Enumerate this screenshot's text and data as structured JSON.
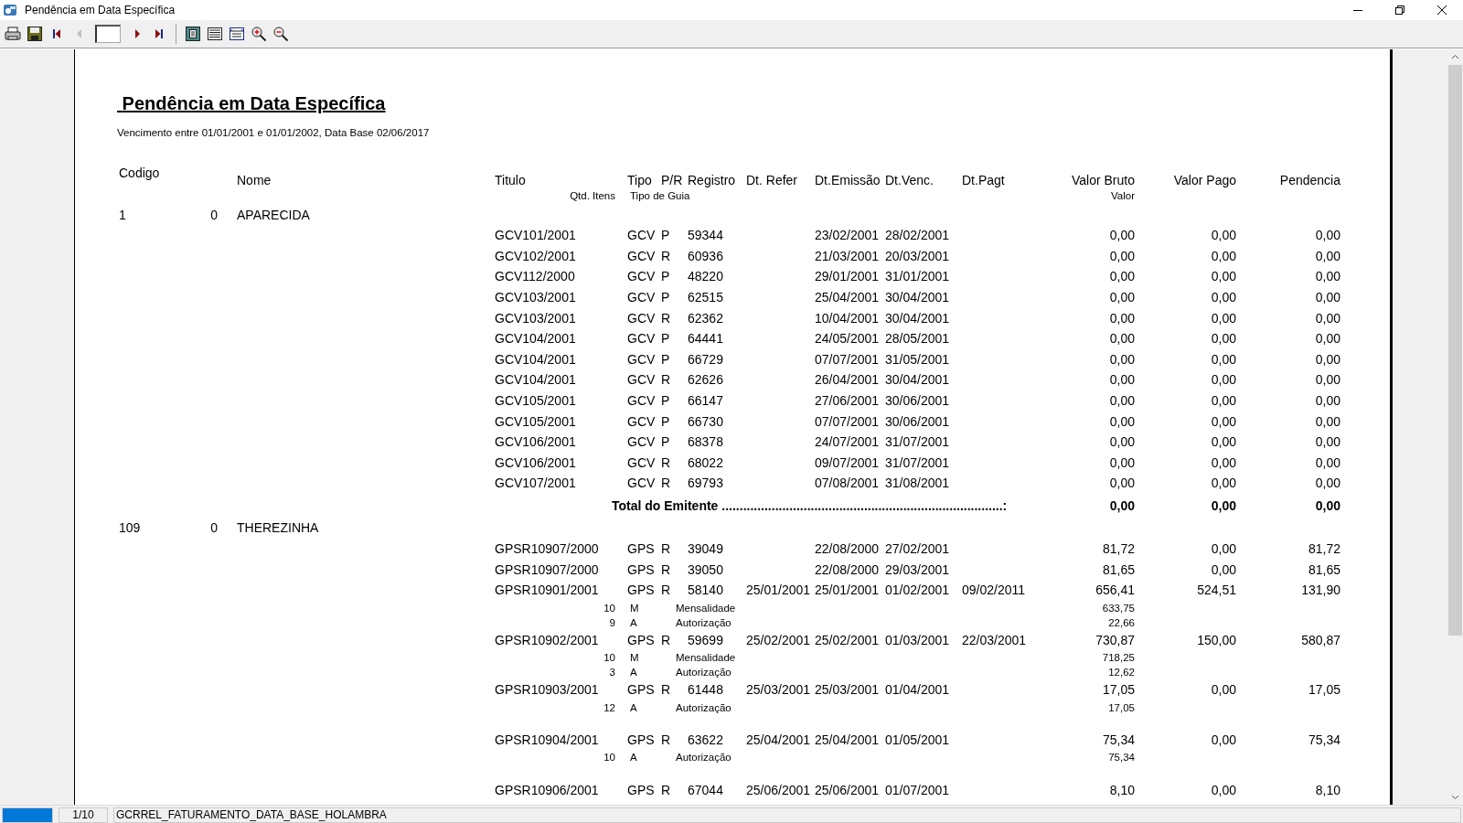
{
  "window": {
    "title": "Pendência em Data Específica"
  },
  "toolbar": {
    "buttons": [
      {
        "kind": "print",
        "disabled": false
      },
      {
        "kind": "save",
        "disabled": false
      },
      {
        "kind": "first",
        "disabled": false
      },
      {
        "kind": "prev",
        "disabled": true
      },
      {
        "kind": "page_field"
      },
      {
        "kind": "next",
        "disabled": false
      },
      {
        "kind": "last",
        "disabled": false
      },
      {
        "kind": "separator"
      },
      {
        "kind": "one_page",
        "disabled": false
      },
      {
        "kind": "lines",
        "disabled": false
      },
      {
        "kind": "page_width",
        "disabled": false
      },
      {
        "kind": "zoom_in",
        "disabled": false
      },
      {
        "kind": "zoom_out",
        "disabled": false
      }
    ]
  },
  "report": {
    "title": "Pendência em Data Específica",
    "subtitle": "Vencimento entre 01/01/2001 e 01/01/2002, Data Base 02/06/2017",
    "columns": [
      "Codigo",
      "Nome",
      "Titulo",
      "Tipo",
      "P/R",
      "Registro",
      "Dt. Refer",
      "Dt.Emissão",
      "Dt.Venc.",
      "Dt.Pagt",
      "Valor Bruto",
      "Valor Pago",
      "Pendencia"
    ],
    "subcolumns": [
      "Qtd. Itens",
      "Tipo de Guia",
      "Valor"
    ],
    "groups": [
      {
        "codigo": "1",
        "column_2": "0",
        "nome": "APARECIDA",
        "rows": [
          {
            "titulo": "GCV101/2001",
            "tipo": "GCV",
            "pr": "P",
            "registro": "59344",
            "dt_emissao": "23/02/2001",
            "dt_venc": "28/02/2001",
            "valor_bruto": "0,00",
            "valor_pago": "0,00",
            "pendencia": "0,00"
          },
          {
            "titulo": "GCV102/2001",
            "tipo": "GCV",
            "pr": "R",
            "registro": "60936",
            "dt_emissao": "21/03/2001",
            "dt_venc": "20/03/2001",
            "valor_bruto": "0,00",
            "valor_pago": "0,00",
            "pendencia": "0,00"
          },
          {
            "titulo": "GCV112/2000",
            "tipo": "GCV",
            "pr": "P",
            "registro": "48220",
            "dt_emissao": "29/01/2001",
            "dt_venc": "31/01/2001",
            "valor_bruto": "0,00",
            "valor_pago": "0,00",
            "pendencia": "0,00"
          },
          {
            "titulo": "GCV103/2001",
            "tipo": "GCV",
            "pr": "P",
            "registro": "62515",
            "dt_emissao": "25/04/2001",
            "dt_venc": "30/04/2001",
            "valor_bruto": "0,00",
            "valor_pago": "0,00",
            "pendencia": "0,00"
          },
          {
            "titulo": "GCV103/2001",
            "tipo": "GCV",
            "pr": "R",
            "registro": "62362",
            "dt_emissao": "10/04/2001",
            "dt_venc": "30/04/2001",
            "valor_bruto": "0,00",
            "valor_pago": "0,00",
            "pendencia": "0,00"
          },
          {
            "titulo": "GCV104/2001",
            "tipo": "GCV",
            "pr": "P",
            "registro": "64441",
            "dt_emissao": "24/05/2001",
            "dt_venc": "28/05/2001",
            "valor_bruto": "0,00",
            "valor_pago": "0,00",
            "pendencia": "0,00"
          },
          {
            "titulo": "GCV104/2001",
            "tipo": "GCV",
            "pr": "P",
            "registro": "66729",
            "dt_emissao": "07/07/2001",
            "dt_venc": "31/05/2001",
            "valor_bruto": "0,00",
            "valor_pago": "0,00",
            "pendencia": "0,00"
          },
          {
            "titulo": "GCV104/2001",
            "tipo": "GCV",
            "pr": "R",
            "registro": "62626",
            "dt_emissao": "26/04/2001",
            "dt_venc": "30/04/2001",
            "valor_bruto": "0,00",
            "valor_pago": "0,00",
            "pendencia": "0,00"
          },
          {
            "titulo": "GCV105/2001",
            "tipo": "GCV",
            "pr": "P",
            "registro": "66147",
            "dt_emissao": "27/06/2001",
            "dt_venc": "30/06/2001",
            "valor_bruto": "0,00",
            "valor_pago": "0,00",
            "pendencia": "0,00"
          },
          {
            "titulo": "GCV105/2001",
            "tipo": "GCV",
            "pr": "P",
            "registro": "66730",
            "dt_emissao": "07/07/2001",
            "dt_venc": "30/06/2001",
            "valor_bruto": "0,00",
            "valor_pago": "0,00",
            "pendencia": "0,00"
          },
          {
            "titulo": "GCV106/2001",
            "tipo": "GCV",
            "pr": "P",
            "registro": "68378",
            "dt_emissao": "24/07/2001",
            "dt_venc": "31/07/2001",
            "valor_bruto": "0,00",
            "valor_pago": "0,00",
            "pendencia": "0,00"
          },
          {
            "titulo": "GCV106/2001",
            "tipo": "GCV",
            "pr": "R",
            "registro": "68022",
            "dt_emissao": "09/07/2001",
            "dt_venc": "31/07/2001",
            "valor_bruto": "0,00",
            "valor_pago": "0,00",
            "pendencia": "0,00"
          },
          {
            "titulo": "GCV107/2001",
            "tipo": "GCV",
            "pr": "R",
            "registro": "69793",
            "dt_emissao": "07/08/2001",
            "dt_venc": "31/08/2001",
            "valor_bruto": "0,00",
            "valor_pago": "0,00",
            "pendencia": "0,00"
          }
        ],
        "total": {
          "label": "Total do Emitente ...............................................................................:",
          "valor_bruto": "0,00",
          "valor_pago": "0,00",
          "pendencia": "0,00"
        }
      },
      {
        "codigo": "109",
        "column_2": "0",
        "nome": "THEREZINHA",
        "rows": [
          {
            "titulo": "GPSR10907/2000",
            "tipo": "GPS",
            "pr": "R",
            "registro": "39049",
            "dt_emissao": "22/08/2000",
            "dt_venc": "27/02/2001",
            "valor_bruto": "81,72",
            "valor_pago": "0,00",
            "pendencia": "81,72"
          },
          {
            "titulo": "GPSR10907/2000",
            "tipo": "GPS",
            "pr": "R",
            "registro": "39050",
            "dt_emissao": "22/08/2000",
            "dt_venc": "29/03/2001",
            "valor_bruto": "81,65",
            "valor_pago": "0,00",
            "pendencia": "81,65"
          },
          {
            "titulo": "GPSR10901/2001",
            "tipo": "GPS",
            "pr": "R",
            "registro": "58140",
            "dt_refer": "25/01/2001",
            "dt_emissao": "25/01/2001",
            "dt_venc": "01/02/2001",
            "dt_pagt": "09/02/2011",
            "valor_bruto": "656,41",
            "valor_pago": "524,51",
            "pendencia": "131,90",
            "items": [
              {
                "qtd": "10",
                "tipo": "M",
                "descricao": "Mensalidade",
                "valor": "633,75"
              },
              {
                "qtd": "9",
                "tipo": "A",
                "descricao": "Autorização",
                "valor": "22,66"
              }
            ]
          },
          {
            "titulo": "GPSR10902/2001",
            "tipo": "GPS",
            "pr": "R",
            "registro": "59699",
            "dt_refer": "25/02/2001",
            "dt_emissao": "25/02/2001",
            "dt_venc": "01/03/2001",
            "dt_pagt": "22/03/2001",
            "valor_bruto": "730,87",
            "valor_pago": "150,00",
            "pendencia": "580,87",
            "items": [
              {
                "qtd": "10",
                "tipo": "M",
                "descricao": "Mensalidade",
                "valor": "718,25"
              },
              {
                "qtd": "3",
                "tipo": "A",
                "descricao": "Autorização",
                "valor": "12,62"
              }
            ]
          },
          {
            "titulo": "GPSR10903/2001",
            "tipo": "GPS",
            "pr": "R",
            "registro": "61448",
            "dt_refer": "25/03/2001",
            "dt_emissao": "25/03/2001",
            "dt_venc": "01/04/2001",
            "valor_bruto": "17,05",
            "valor_pago": "0,00",
            "pendencia": "17,05",
            "items": [
              {
                "qtd": "12",
                "tipo": "A",
                "descricao": "Autorização",
                "valor": "17,05"
              }
            ]
          },
          {
            "titulo": "GPSR10904/2001",
            "tipo": "GPS",
            "pr": "R",
            "registro": "63622",
            "dt_refer": "25/04/2001",
            "dt_emissao": "25/04/2001",
            "dt_venc": "01/05/2001",
            "valor_bruto": "75,34",
            "valor_pago": "0,00",
            "pendencia": "75,34",
            "items": [
              {
                "qtd": "10",
                "tipo": "A",
                "descricao": "Autorização",
                "valor": "75,34"
              }
            ]
          },
          {
            "titulo": "GPSR10906/2001",
            "tipo": "GPS",
            "pr": "R",
            "registro": "67044",
            "dt_refer": "25/06/2001",
            "dt_emissao": "25/06/2001",
            "dt_venc": "01/07/2001",
            "valor_bruto": "8,10",
            "valor_pago": "0,00",
            "pendencia": "8,10"
          }
        ]
      }
    ]
  },
  "status_bar": {
    "progress": {
      "level": 1
    },
    "page": "1/10",
    "report_name": "GCRREL_FATURAMENTO_DATA_BASE_HOLAMBRA"
  }
}
